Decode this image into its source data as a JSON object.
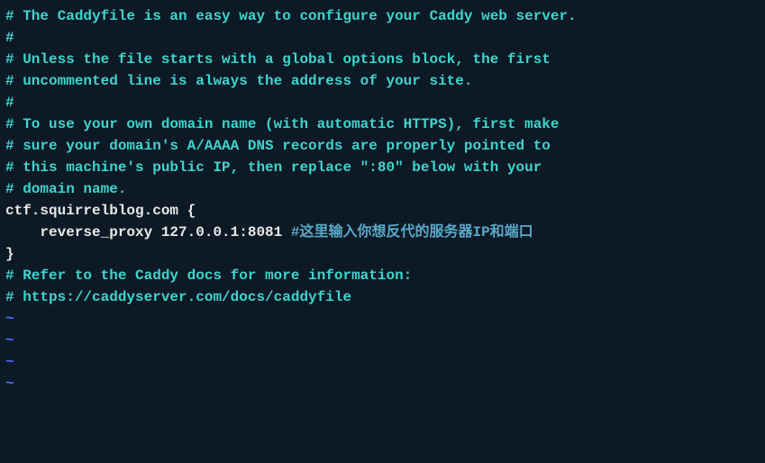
{
  "lines": {
    "c1": "# The Caddyfile is an easy way to configure your Caddy web server.",
    "c2": "#",
    "c3": "# Unless the file starts with a global options block, the first",
    "c4": "# uncommented line is always the address of your site.",
    "c5": "#",
    "c6": "# To use your own domain name (with automatic HTTPS), first make",
    "c7": "# sure your domain's A/AAAA DNS records are properly pointed to",
    "c8": "# this machine's public IP, then replace \":80\" below with your",
    "c9": "# domain name.",
    "blank1": "",
    "cfg1": "ctf.squirrelblog.com {",
    "cfg2a": "    reverse_proxy 127.0.0.1:8081 ",
    "cfg2b": "#这里输入你想反代的服务器IP和端口",
    "blank2": "",
    "cfg3": "}",
    "blank3": "",
    "c10": "# Refer to the Caddy docs for more information:",
    "c11": "# https://caddyserver.com/docs/caddyfile",
    "t1": "~",
    "t2": "~",
    "t3": "~",
    "t4": "~"
  }
}
